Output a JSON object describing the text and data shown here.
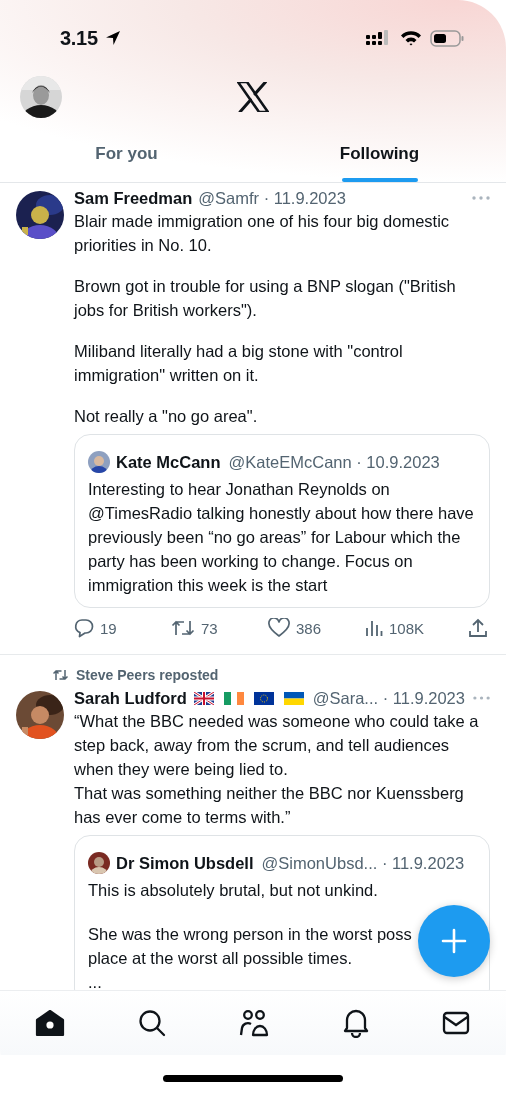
{
  "status_bar": {
    "time": "3.15"
  },
  "tabs": [
    {
      "label": "For you",
      "selected": false
    },
    {
      "label": "Following",
      "selected": true
    }
  ],
  "posts": [
    {
      "name": "Sam Freedman",
      "meta": "@Samfr · 11.9.2023",
      "body": [
        "Blair made immigration one of his four big domestic priorities in No. 10.",
        "Brown got in trouble for using a BNP slogan (\"British jobs for British workers\").",
        "Miliband literally had a big stone with \"control immigration\" written on it.",
        "Not really a \"no go area\"."
      ],
      "quote": {
        "name": "Kate McCann",
        "meta": "@KateEMcCann · 10.9.2023",
        "body": [
          "Interesting to hear Jonathan Reynolds on @TimesRadio talking honestly about how there have previously been “no go areas” for Labour which the party has been working to change. Focus on immigration this week is the start"
        ]
      },
      "stats": {
        "replies": "19",
        "reposts": "73",
        "likes": "386",
        "views": "108K"
      }
    },
    {
      "reposted_by": "Steve Peers reposted",
      "name": "Sarah Ludford",
      "name_flags": [
        {
          "kind": "uk"
        },
        {
          "kind": "ireland"
        },
        {
          "kind": "eu"
        },
        {
          "kind": "ukraine"
        }
      ],
      "meta": "@Sara... · 11.9.2023",
      "body": [
        "“What the BBC needed was someone who could take a step back, away from the scrum, and tell audiences when they were being lied to.\nThat was something neither the BBC nor Kuenssberg has ever come to terms with.”"
      ],
      "quote": {
        "name": "Dr Simon Ubsdell",
        "meta": "@SimonUbsd... · 11.9.2023",
        "body": [
          "This is absolutely brutal, but not unkind.",
          "She was the wrong person in the worst poss\nplace at the worst all possible times.\n..."
        ]
      }
    }
  ],
  "nav_items": [
    {
      "kind": "home",
      "selected": true
    },
    {
      "kind": "search",
      "selected": false
    },
    {
      "kind": "communities",
      "selected": false
    },
    {
      "kind": "notifications",
      "selected": false
    },
    {
      "kind": "messages",
      "selected": false
    }
  ]
}
